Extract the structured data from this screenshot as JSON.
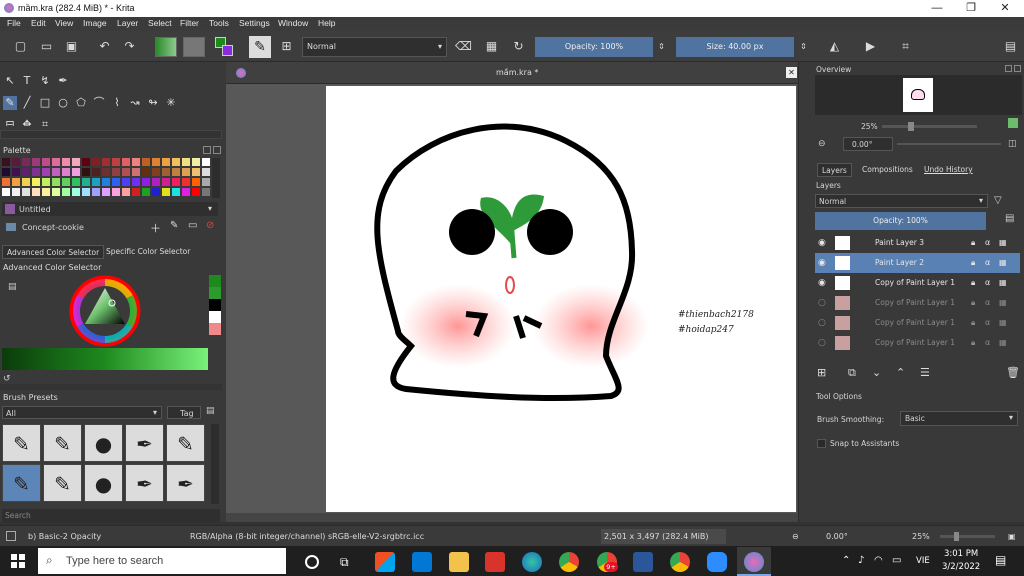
{
  "window": {
    "title": "mầm.kra (282.4 MiB)  * - Krita",
    "minimize": "—",
    "maximize": "❐",
    "close": "✕"
  },
  "menu": [
    "File",
    "Edit",
    "View",
    "Image",
    "Layer",
    "Select",
    "Filter",
    "Tools",
    "Settings",
    "Window",
    "Help"
  ],
  "toolbar": {
    "blend_mode": "Normal",
    "opacity_label": "Opacity: 100%",
    "size_label": "Size: 40.00 px"
  },
  "canvas": {
    "tab_title": "mầm.kra *",
    "close": "✕",
    "watermark1": "#thienbach2178",
    "watermark2": "#hoidap247"
  },
  "left": {
    "palette_title": "Palette",
    "palette_name": "Untitled",
    "resource_name": "Concept-cookie",
    "tab_advanced": "Advanced Color Selector",
    "tab_specific": "Specific Color Selector",
    "advanced_title": "Advanced Color Selector",
    "brush_presets_title": "Brush Presets",
    "brush_filter": "All",
    "tag_label": "Tag",
    "search_placeholder": "Search"
  },
  "right": {
    "overview_title": "Overview",
    "zoom": "25%",
    "rotation": "0.00°",
    "tabs": [
      "Layers",
      "Compositions",
      "Undo History"
    ],
    "layers_title": "Layers",
    "layer_blend": "Normal",
    "layer_opacity": "Opacity:  100%",
    "layers": [
      {
        "name": "Paint Layer 3",
        "visible": true,
        "selected": false
      },
      {
        "name": "Paint Layer 2",
        "visible": true,
        "selected": true
      },
      {
        "name": "Copy of Paint Layer 1",
        "visible": true,
        "selected": false
      },
      {
        "name": "Copy of Paint Layer 1",
        "visible": false,
        "selected": false
      },
      {
        "name": "Copy of Paint Layer 1",
        "visible": false,
        "selected": false
      },
      {
        "name": "Copy of Paint Layer 1",
        "visible": false,
        "selected": false
      }
    ],
    "tool_options_title": "Tool Options",
    "brush_smoothing_label": "Brush Smoothing:",
    "brush_smoothing_value": "Basic",
    "snap_label": "Snap to Assistants"
  },
  "status": {
    "brush": "b) Basic-2 Opacity",
    "color_model": "RGB/Alpha (8-bit integer/channel)  sRGB-elle-V2-srgbtrc.icc",
    "dimensions": "2,501 x 3,497 (282.4 MiB)",
    "rotation": "0.00°",
    "zoom": "25%"
  },
  "taskbar": {
    "search_placeholder": "Type here to search",
    "language": "VIE",
    "time": "3:01 PM",
    "date": "3/2/2022",
    "notif_badge": "9+"
  },
  "colors": {
    "accent": "#50749f",
    "selected_layer": "#5a81b3",
    "fg_color": "#1e8a1e",
    "bg_color": "#ffffff"
  }
}
